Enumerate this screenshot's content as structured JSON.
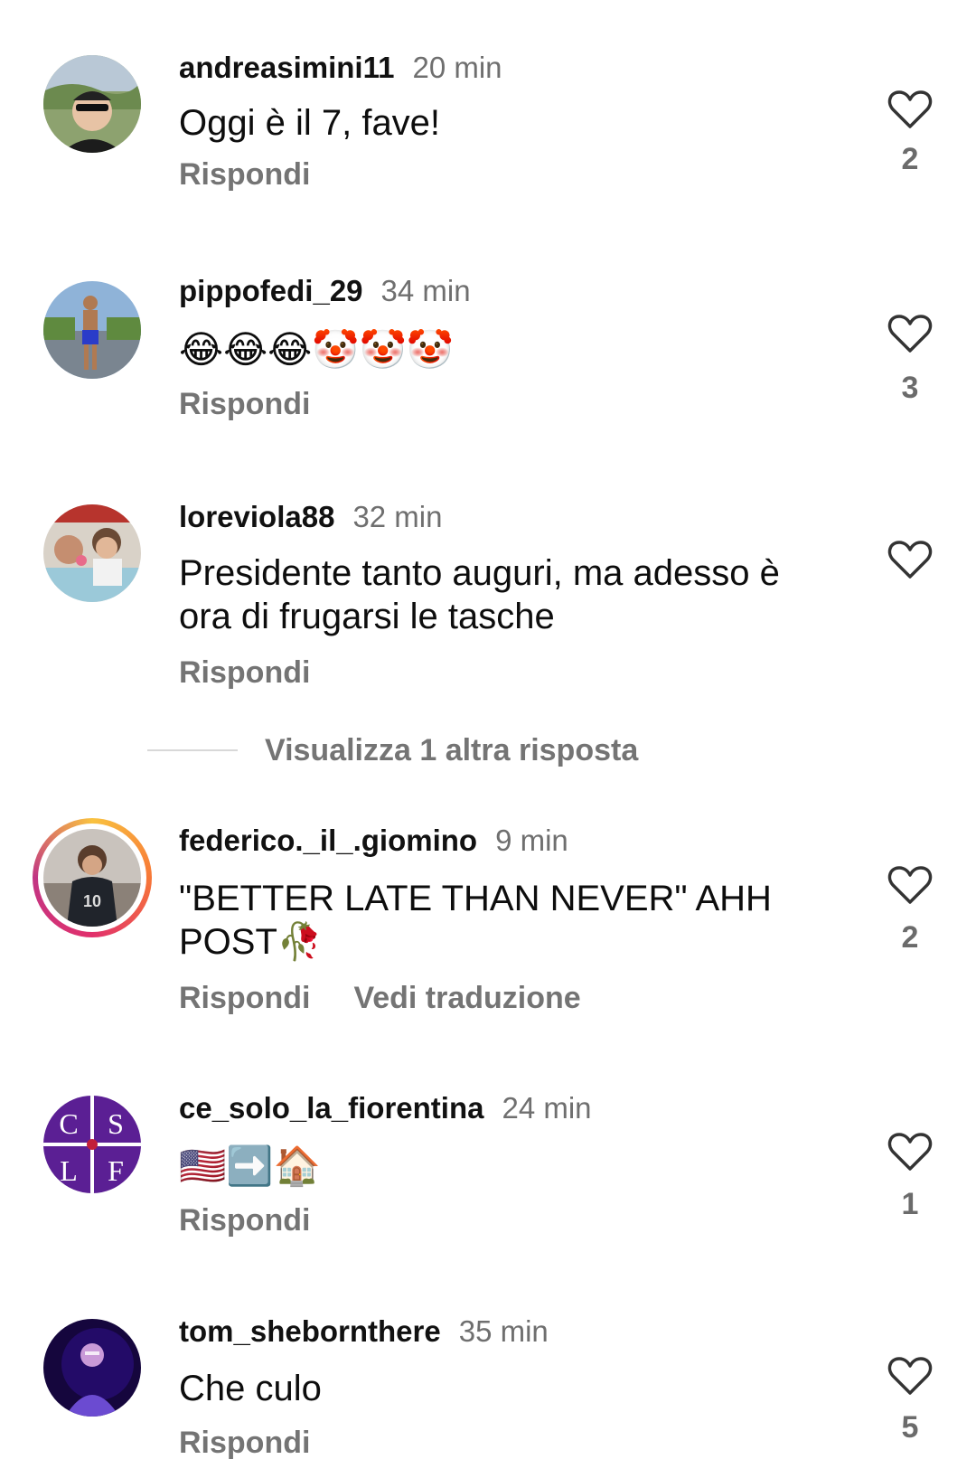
{
  "comments": [
    {
      "username": "andreasimini11",
      "time": "20 min",
      "text": "Oggi è il 7, fave!",
      "reply_label": "Rispondi",
      "likes": "2"
    },
    {
      "username": "pippofedi_29",
      "time": "34 min",
      "text": "😂😂😂🤡🤡🤡",
      "reply_label": "Rispondi",
      "likes": "3"
    },
    {
      "username": "loreviola88",
      "time": "32 min",
      "text": "Presidente tanto auguri, ma adesso è ora di frugarsi le tasche",
      "reply_label": "Rispondi",
      "likes": ""
    },
    {
      "username": "federico._il_.giomino",
      "time": "9 min",
      "text": "\"BETTER LATE THAN NEVER\" AHH POST🥀",
      "reply_label": "Rispondi",
      "translate_label": "Vedi traduzione",
      "likes": "2"
    },
    {
      "username": "ce_solo_la_fiorentina",
      "time": "24 min",
      "text": "🇺🇸➡️🏠",
      "reply_label": "Rispondi",
      "likes": "1"
    },
    {
      "username": "tom_shebornthere",
      "time": "35 min",
      "text": "Che culo",
      "reply_label": "Rispondi",
      "likes": "5"
    }
  ],
  "view_replies_label": "Visualizza 1 altra risposta",
  "avatar_badge": {
    "letters": [
      "C",
      "S",
      "L",
      "F"
    ]
  },
  "colors": {
    "username": "#111111",
    "secondary": "#747474",
    "story_ring": "#e1306c",
    "badge_purple": "#5b1f94"
  }
}
